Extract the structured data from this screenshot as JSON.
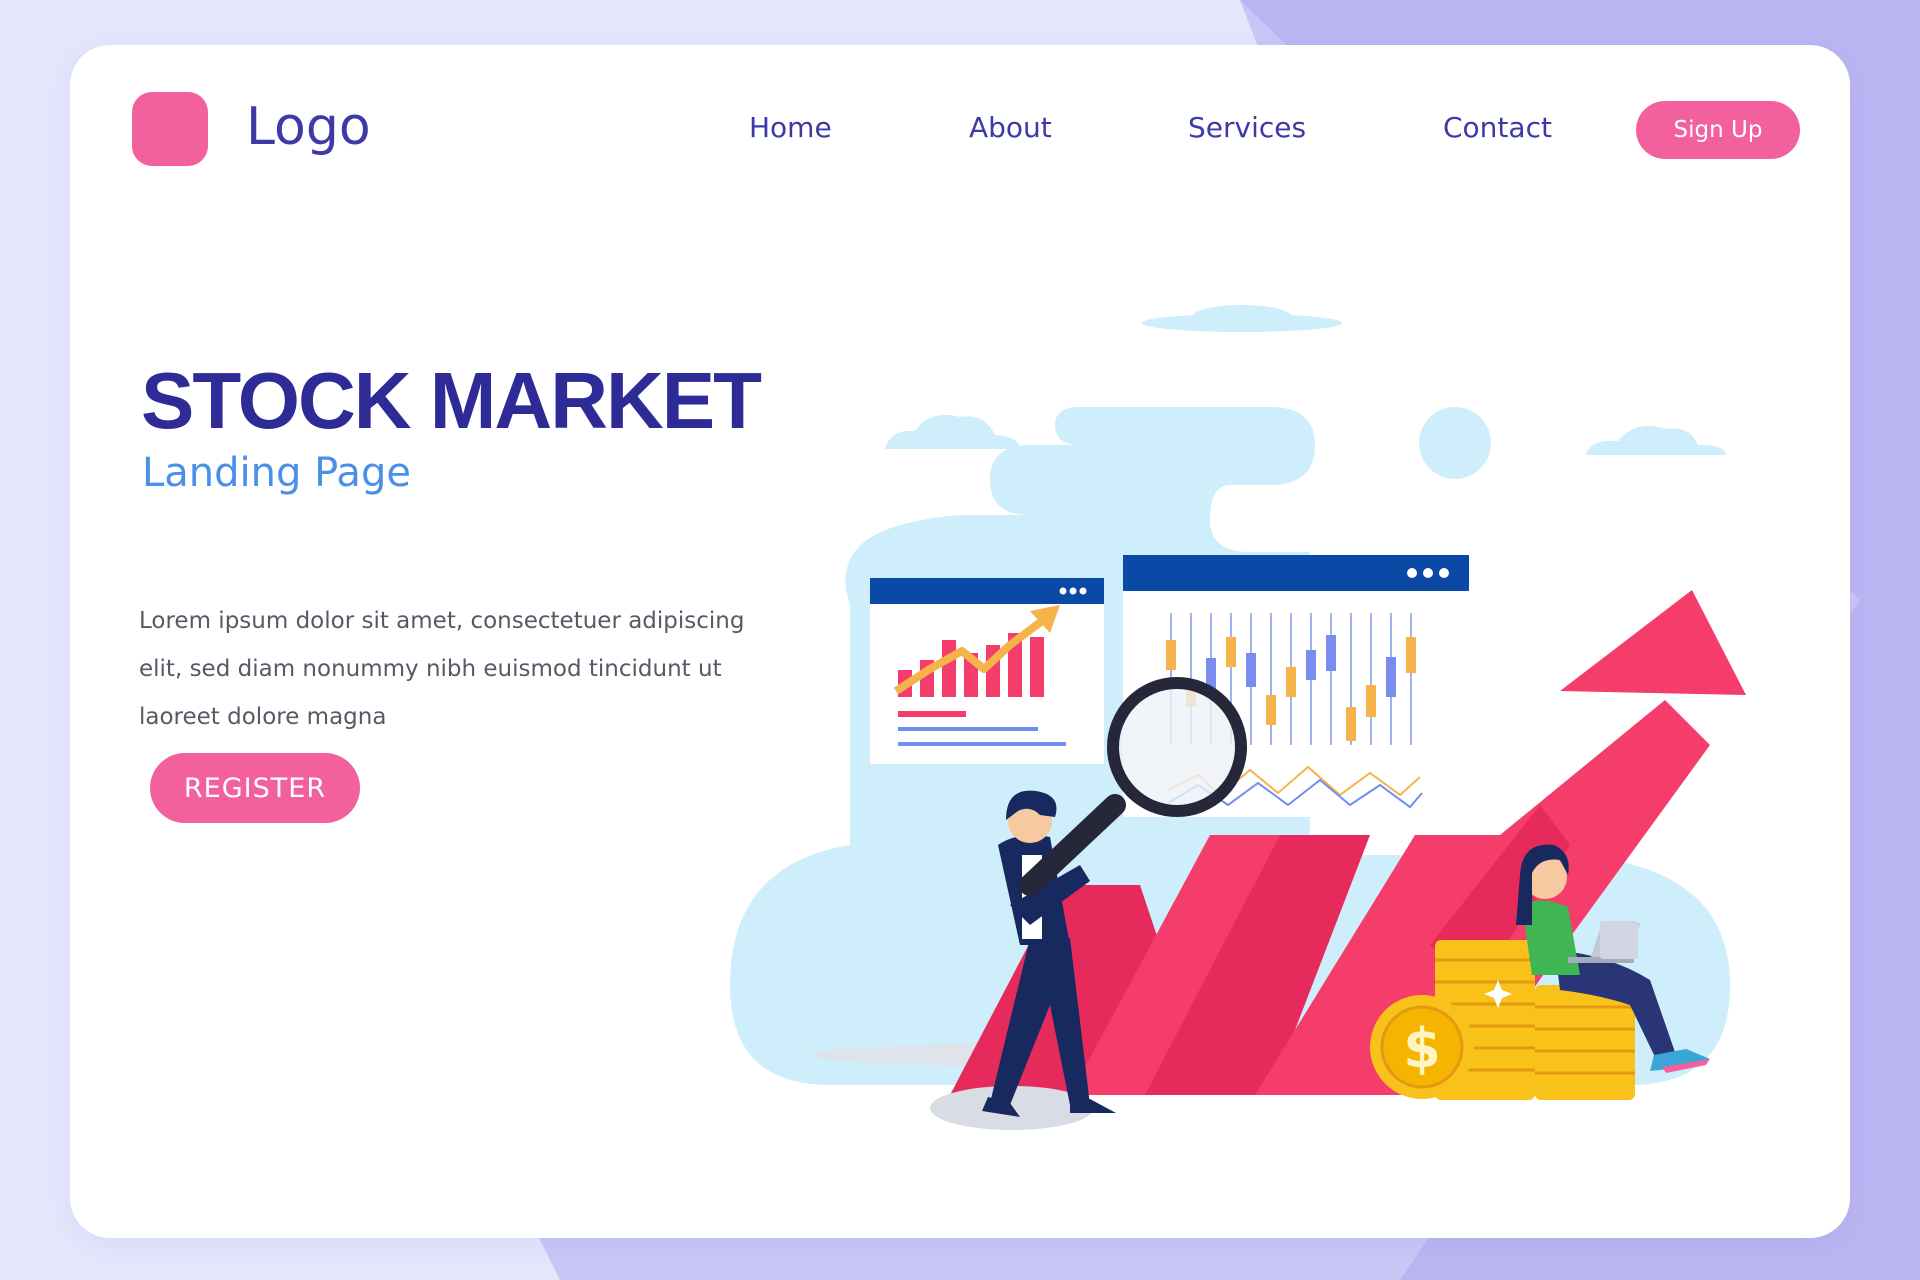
{
  "brand": {
    "logo_text": "Logo"
  },
  "nav": {
    "items": [
      {
        "label": "Home"
      },
      {
        "label": "About"
      },
      {
        "label": "Services"
      },
      {
        "label": "Contact"
      }
    ],
    "signup_label": "Sign Up"
  },
  "hero": {
    "title": "STOCK MARKET",
    "subtitle": "Landing Page",
    "description": "Lorem ipsum dolor sit amet, consectetuer adipiscing elit, sed diam nonummy nibh euismod tincidunt ut laoreet dolore magna",
    "register_label": "REGISTER"
  },
  "illustration": {
    "coin_symbol": "$",
    "icons": [
      "magnifier-icon",
      "growth-arrow-icon",
      "coin-icon",
      "laptop-icon"
    ]
  },
  "colors": {
    "accent_pink": "#f2619e",
    "brand_indigo": "#2e2b96",
    "nav_indigo": "#3d3aa8",
    "subtitle_blue": "#4c8fe6",
    "arrow_red": "#f43d6b",
    "cloud_blue": "#cdeefa",
    "window_header_blue": "#0b49a7",
    "coin_gold": "#f8c21a",
    "page_background": "#e4e6fc"
  }
}
